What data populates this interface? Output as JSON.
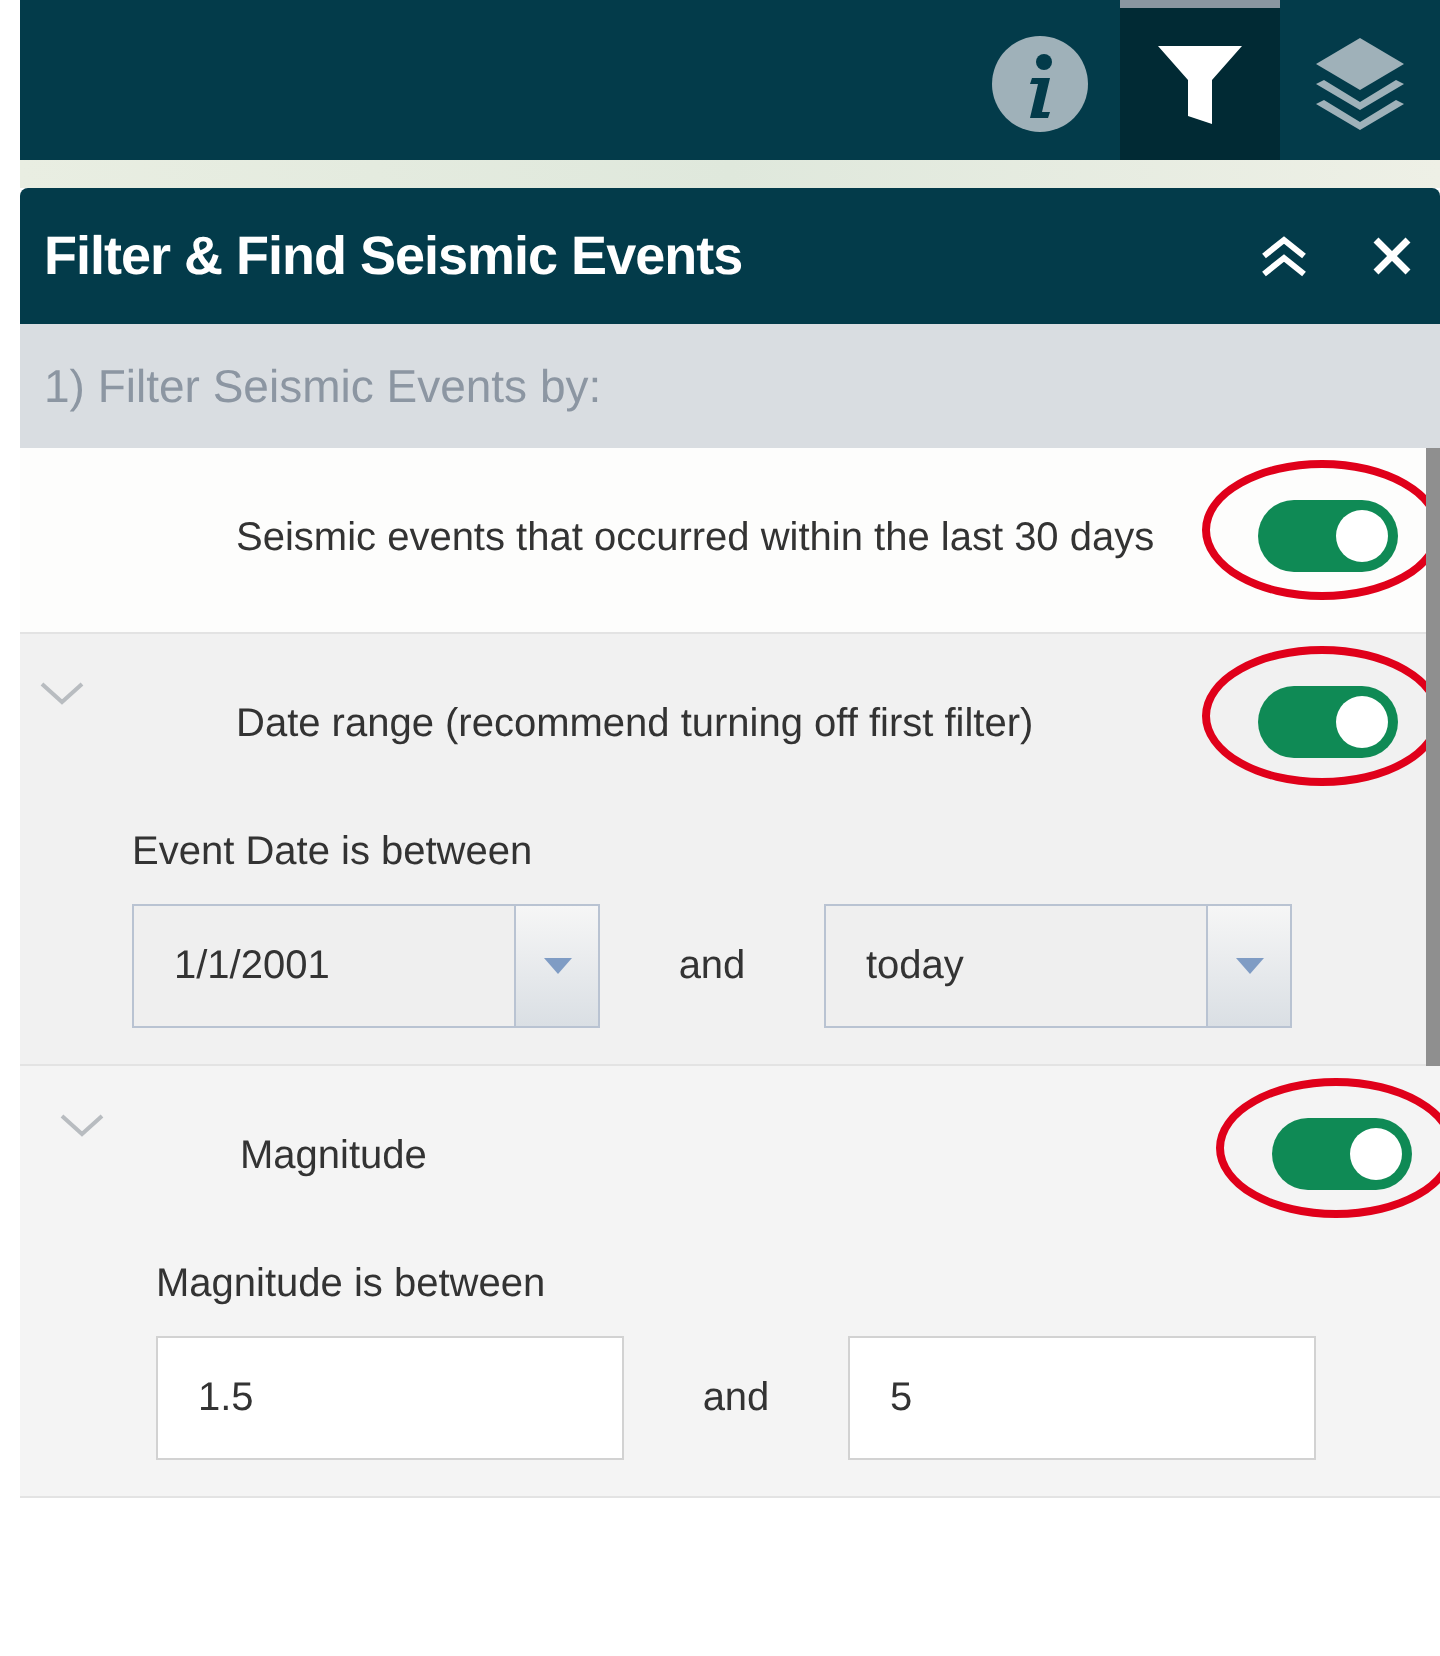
{
  "toolbar": {
    "buttons": [
      {
        "kind": "info",
        "selected": false
      },
      {
        "kind": "filter",
        "selected": true
      },
      {
        "kind": "layers",
        "selected": false
      }
    ]
  },
  "panel": {
    "title": "Filter & Find Seismic Events",
    "section_heading": "1) Filter Seismic Events by:",
    "filters": [
      {
        "kind": "simple",
        "label": "Seismic events that occurred within the last 30 days",
        "on": true,
        "highlighted": true
      },
      {
        "kind": "range",
        "label": "Date range (recommend turning off first filter)",
        "on": true,
        "highlighted": true,
        "expanded": true,
        "caption": "Event Date is between",
        "joiner": "and",
        "from": {
          "kind": "dropdown",
          "value": "1/1/2001"
        },
        "to": {
          "kind": "dropdown",
          "value": "today"
        }
      },
      {
        "kind": "range",
        "label": "Magnitude",
        "on": true,
        "highlighted": true,
        "expanded": true,
        "caption": "Magnitude is between",
        "joiner": "and",
        "from": {
          "kind": "text",
          "value": "1.5"
        },
        "to": {
          "kind": "text",
          "value": "5"
        }
      }
    ]
  }
}
